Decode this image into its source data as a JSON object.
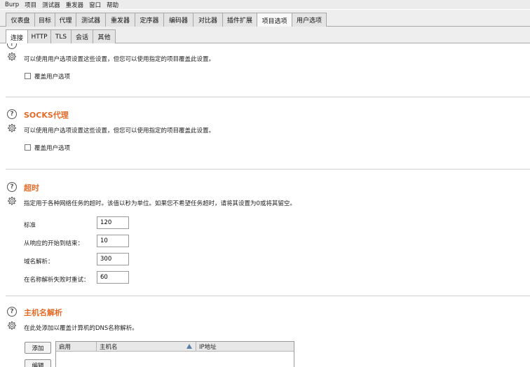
{
  "menubar": {
    "items": [
      "Burp",
      "项目",
      "测试器",
      "重发器",
      "窗口",
      "帮助"
    ]
  },
  "main_tabs": [
    "仪表盘",
    "目标",
    "代理",
    "测试器",
    "重发器",
    "定序器",
    "编码器",
    "对比器",
    "插件扩展",
    "项目选项",
    "用户选项"
  ],
  "sub_tabs": [
    "连接",
    "HTTP",
    "TLS",
    "会话",
    "其他"
  ],
  "sections": {
    "top": {
      "desc": "可以使用用户选项设置这些设置，但您可以使用指定的项目覆盖此设置。",
      "checkbox_label": "覆盖用户选项"
    },
    "socks": {
      "title": "SOCKS代理",
      "desc": "可以使用用户选项设置这些设置，但您可以使用指定的项目覆盖此设置。",
      "checkbox_label": "覆盖用户选项"
    },
    "timeouts": {
      "title": "超时",
      "desc": "指定用于各种网络任务的超时。该值以秒为单位。如果您不希望任务超时，请将其设置为0或将其留空。",
      "fields": [
        {
          "label": "标准",
          "value": "120"
        },
        {
          "label": "从响应的开始到结束：",
          "value": "10"
        },
        {
          "label": "域名解析：",
          "value": "300"
        },
        {
          "label": "在名称解析失败时重试：",
          "value": "60"
        }
      ]
    },
    "hostname": {
      "title": "主机名解析",
      "desc": "在此处添加以覆盖计算机的DNS名称解析。",
      "add_button": "添加",
      "edit_button": "编辑",
      "columns": [
        "启用",
        "主机名",
        "IP地址"
      ]
    }
  }
}
